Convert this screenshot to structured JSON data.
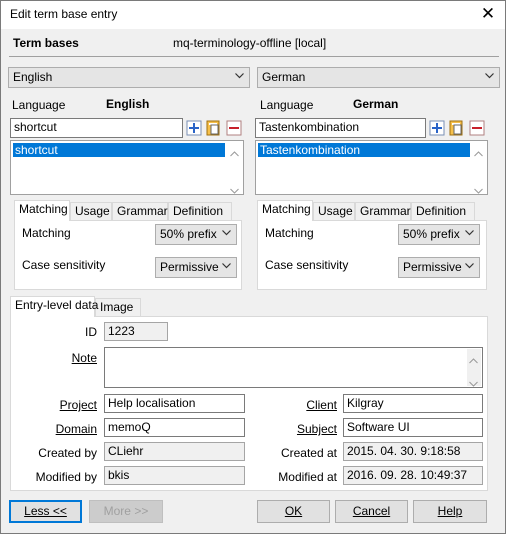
{
  "window": {
    "title": "Edit term base entry"
  },
  "term_bases": {
    "label": "Term bases",
    "value": "mq-terminology-offline [local]"
  },
  "left": {
    "language_select": "English",
    "language_label": "Language",
    "language_value": "English",
    "term_input": "shortcut",
    "terms": [
      "shortcut"
    ],
    "tabs": [
      "Matching",
      "Usage",
      "Grammar",
      "Definition"
    ],
    "matching_label": "Matching",
    "matching_value": "50% prefix",
    "case_label": "Case sensitivity",
    "case_value": "Permissive"
  },
  "right": {
    "language_select": "German",
    "language_label": "Language",
    "language_value": "German",
    "term_input": "Tastenkombination",
    "terms": [
      "Tastenkombination"
    ],
    "tabs": [
      "Matching",
      "Usage",
      "Grammar",
      "Definition"
    ],
    "matching_label": "Matching",
    "matching_value": "50% prefix",
    "case_label": "Case sensitivity",
    "case_value": "Permissive"
  },
  "entry": {
    "tabs": [
      "Entry-level data",
      "Image"
    ],
    "id_label": "ID",
    "id_value": "1223",
    "note_label": "Note",
    "note_value": "",
    "project_label": "Project",
    "project_value": "Help localisation",
    "client_label": "Client",
    "client_value": "Kilgray",
    "domain_label": "Domain",
    "domain_value": "memoQ",
    "subject_label": "Subject",
    "subject_value": "Software UI",
    "created_by_label": "Created by",
    "created_by_value": "CLiehr",
    "created_at_label": "Created at",
    "created_at_value": "2015. 04. 30. 9:18:58",
    "modified_by_label": "Modified by",
    "modified_by_value": "bkis",
    "modified_at_label": "Modified at",
    "modified_at_value": "2016. 09. 28. 10:49:37"
  },
  "buttons": {
    "less": "Less <<",
    "more": "More >>",
    "ok": "OK",
    "cancel": "Cancel",
    "help": "Help"
  },
  "colors": {
    "selection": "#0078d7",
    "default_border": "#0078d7"
  }
}
